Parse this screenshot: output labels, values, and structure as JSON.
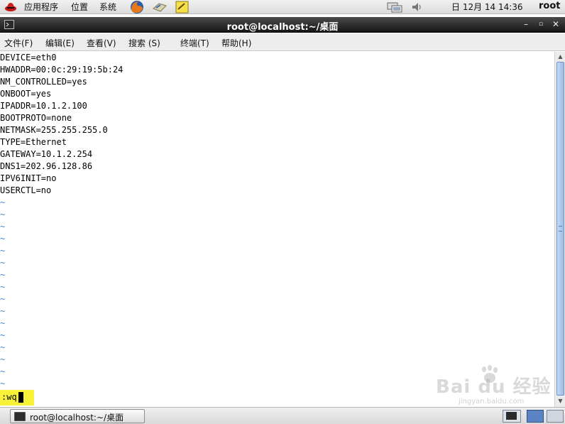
{
  "top_panel": {
    "menus": [
      "应用程序",
      "位置",
      "系统"
    ],
    "datetime": "日 12月 14 14:36",
    "user": "root"
  },
  "window": {
    "title": "root@localhost:~/桌面",
    "menu": [
      "文件(F)",
      "编辑(E)",
      "查看(V)",
      "搜索 (S)",
      "终端(T)",
      "帮助(H)"
    ]
  },
  "terminal": {
    "lines": [
      "DEVICE=eth0",
      "HWADDR=00:0c:29:19:5b:24",
      "NM_CONTROLLED=yes",
      "ONBOOT=yes",
      "IPADDR=10.1.2.100",
      "BOOTPROTO=none",
      "NETMASK=255.255.255.0",
      "TYPE=Ethernet",
      "GATEWAY=10.1.2.254",
      "DNS1=202.96.128.86",
      "IPV6INIT=no",
      "USERCTL=no"
    ],
    "tilde": "~",
    "command": ":wq"
  },
  "taskbar": {
    "task_label": "root@localhost:~/桌面"
  },
  "watermark": {
    "text": "Bai du 经验",
    "sub": "jingyan.baidu.com"
  },
  "icons": {
    "redhat": "redhat-icon",
    "firefox": "firefox-icon",
    "mail": "mail-icon",
    "notes": "notes-icon",
    "network": "network-icon",
    "volume": "volume-icon"
  }
}
